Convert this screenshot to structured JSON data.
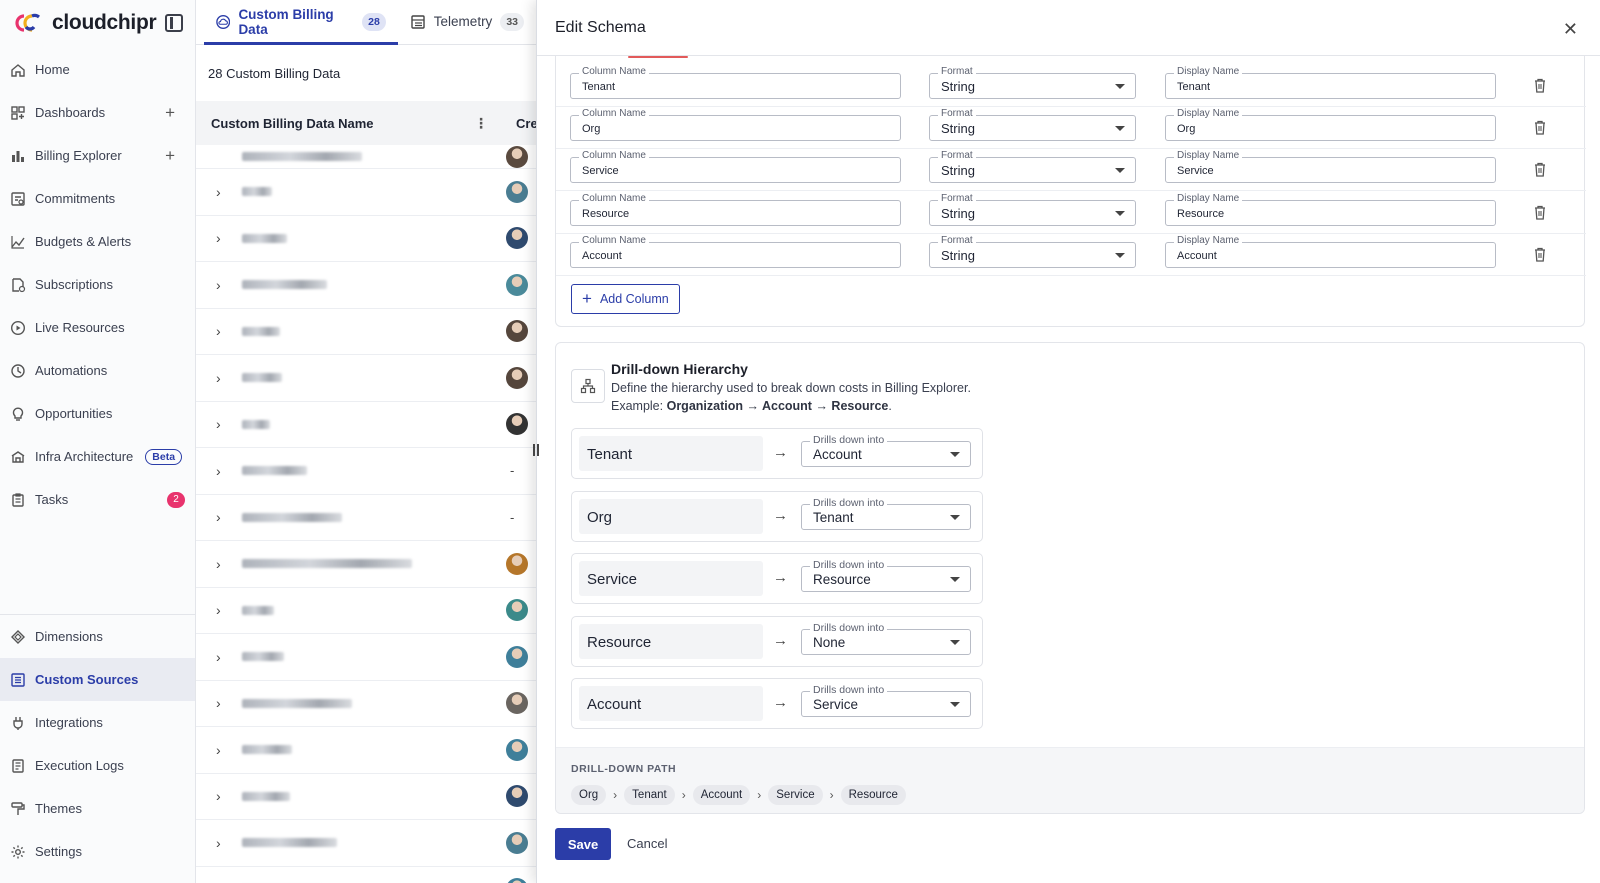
{
  "brand": {
    "name": "cloudchipr"
  },
  "sidebar": {
    "items": [
      {
        "label": "Home",
        "icon": "home-icon"
      },
      {
        "label": "Dashboards",
        "icon": "dashboard-icon",
        "plus": "+"
      },
      {
        "label": "Billing Explorer",
        "icon": "bar-chart-icon",
        "plus": "+"
      },
      {
        "label": "Commitments",
        "icon": "commitments-icon"
      },
      {
        "label": "Budgets & Alerts",
        "icon": "trend-icon"
      },
      {
        "label": "Subscriptions",
        "icon": "subscriptions-icon"
      },
      {
        "label": "Live Resources",
        "icon": "play-circle-icon"
      },
      {
        "label": "Automations",
        "icon": "automation-icon"
      },
      {
        "label": "Opportunities",
        "icon": "lightbulb-icon"
      },
      {
        "label": "Infra Architecture",
        "icon": "architecture-icon",
        "beta": "Beta"
      },
      {
        "label": "Tasks",
        "icon": "clipboard-icon",
        "badge": "2"
      }
    ],
    "bottom_items": [
      {
        "label": "Dimensions",
        "icon": "dimensions-icon"
      },
      {
        "label": "Custom Sources",
        "icon": "list-icon",
        "active": true
      },
      {
        "label": "Integrations",
        "icon": "plug-icon"
      },
      {
        "label": "Execution Logs",
        "icon": "log-icon"
      },
      {
        "label": "Themes",
        "icon": "paint-roller-icon"
      },
      {
        "label": "Settings",
        "icon": "gear-icon"
      }
    ]
  },
  "tabs": [
    {
      "label": "Custom Billing Data",
      "count": "28",
      "active": true
    },
    {
      "label": "Telemetry",
      "count": "33",
      "active": false
    }
  ],
  "list": {
    "count_label": "28 Custom Billing Data",
    "header_name": "Custom Billing Data Name",
    "header_created": "Crea",
    "rows_created_dash": "-"
  },
  "panel": {
    "title": "Edit Schema",
    "labels": {
      "column_name": "Column Name",
      "format": "Format",
      "display_name": "Display Name"
    },
    "columns": [
      {
        "column_name": "Tenant",
        "format": "String",
        "display_name": "Tenant"
      },
      {
        "column_name": "Org",
        "format": "String",
        "display_name": "Org"
      },
      {
        "column_name": "Service",
        "format": "String",
        "display_name": "Service"
      },
      {
        "column_name": "Resource",
        "format": "String",
        "display_name": "Resource"
      },
      {
        "column_name": "Account",
        "format": "String",
        "display_name": "Account"
      }
    ],
    "add_column_label": "Add Column",
    "hierarchy": {
      "title": "Drill-down Hierarchy",
      "description": "Define the hierarchy used to break down costs in Billing Explorer.",
      "example_prefix": "Example: ",
      "example_path": "Organization → Account → Resource",
      "example_suffix": ".",
      "drills_label": "Drills down into",
      "levels": [
        {
          "name": "Tenant",
          "drills_into": "Account"
        },
        {
          "name": "Org",
          "drills_into": "Tenant"
        },
        {
          "name": "Service",
          "drills_into": "Resource"
        },
        {
          "name": "Resource",
          "drills_into": "None"
        },
        {
          "name": "Account",
          "drills_into": "Service"
        }
      ],
      "path_label": "DRILL-DOWN PATH",
      "path": [
        "Org",
        "Tenant",
        "Account",
        "Service",
        "Resource"
      ]
    },
    "save_label": "Save",
    "cancel_label": "Cancel"
  },
  "colors": {
    "accent": "#2b3da8",
    "badge": "#e8336d",
    "danger_fragment": "#e25a5a"
  }
}
